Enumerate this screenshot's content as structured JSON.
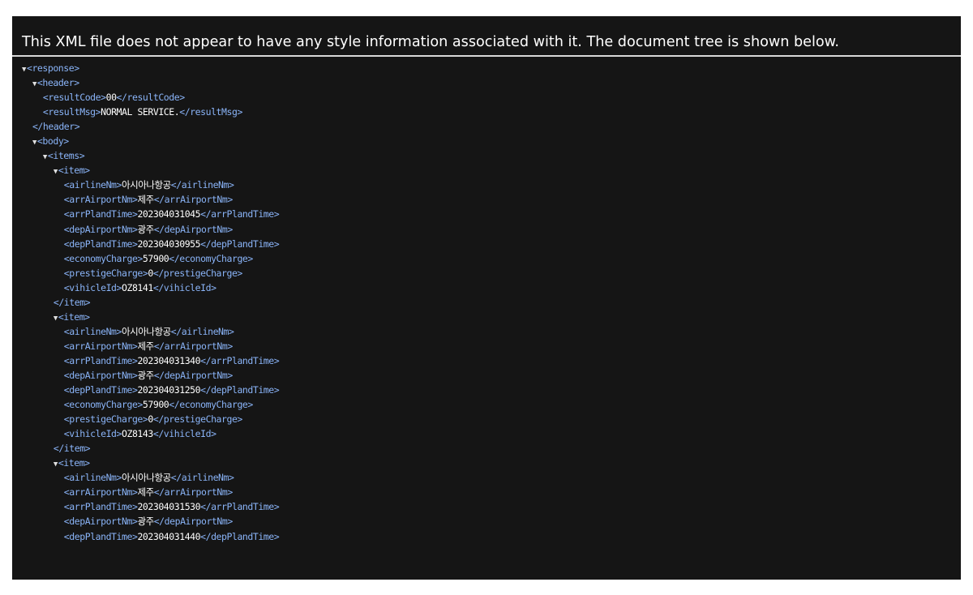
{
  "info_message": "This XML file does not appear to have any style information associated with it. The document tree is shown below.",
  "toggle_glyph": "▼",
  "tree": {
    "root_tag": "response",
    "header": {
      "tag": "header",
      "result_code": {
        "tag": "resultCode",
        "value": "00"
      },
      "result_msg": {
        "tag": "resultMsg",
        "value": "NORMAL SERVICE."
      }
    },
    "body": {
      "tag": "body",
      "items_tag": "items",
      "item_tag": "item",
      "items": [
        {
          "fields": [
            {
              "tag": "airlineNm",
              "value": "아시아나항공"
            },
            {
              "tag": "arrAirportNm",
              "value": "제주"
            },
            {
              "tag": "arrPlandTime",
              "value": "202304031045"
            },
            {
              "tag": "depAirportNm",
              "value": "광주"
            },
            {
              "tag": "depPlandTime",
              "value": "202304030955"
            },
            {
              "tag": "economyCharge",
              "value": "57900"
            },
            {
              "tag": "prestigeCharge",
              "value": "0"
            },
            {
              "tag": "vihicleId",
              "value": "OZ8141"
            }
          ]
        },
        {
          "fields": [
            {
              "tag": "airlineNm",
              "value": "아시아나항공"
            },
            {
              "tag": "arrAirportNm",
              "value": "제주"
            },
            {
              "tag": "arrPlandTime",
              "value": "202304031340"
            },
            {
              "tag": "depAirportNm",
              "value": "광주"
            },
            {
              "tag": "depPlandTime",
              "value": "202304031250"
            },
            {
              "tag": "economyCharge",
              "value": "57900"
            },
            {
              "tag": "prestigeCharge",
              "value": "0"
            },
            {
              "tag": "vihicleId",
              "value": "OZ8143"
            }
          ]
        },
        {
          "fields": [
            {
              "tag": "airlineNm",
              "value": "아시아나항공"
            },
            {
              "tag": "arrAirportNm",
              "value": "제주"
            },
            {
              "tag": "arrPlandTime",
              "value": "202304031530"
            },
            {
              "tag": "depAirportNm",
              "value": "광주"
            },
            {
              "tag": "depPlandTime",
              "value": "202304031440"
            }
          ]
        }
      ]
    }
  }
}
